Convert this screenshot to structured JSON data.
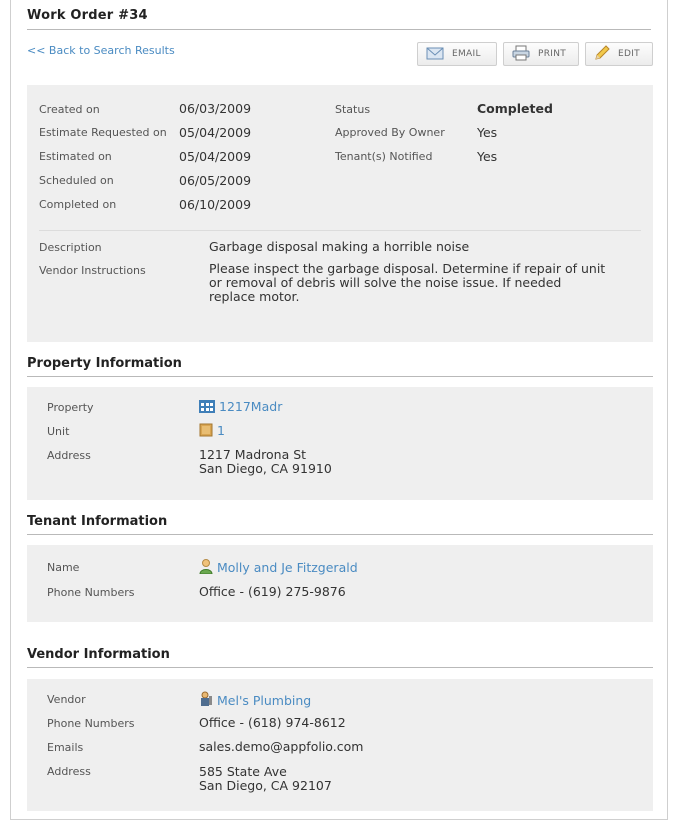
{
  "header": {
    "title": "Work Order #34",
    "back_link": "<< Back to Search Results"
  },
  "toolbar": {
    "email_label": "EMAIL",
    "print_label": "PRINT",
    "edit_label": "EDIT"
  },
  "work_order": {
    "created_on_label": "Created on",
    "created_on": "06/03/2009",
    "estimate_requested_label": "Estimate Requested on",
    "estimate_requested": "05/04/2009",
    "estimated_on_label": "Estimated on",
    "estimated_on": "05/04/2009",
    "scheduled_on_label": "Scheduled on",
    "scheduled_on": "06/05/2009",
    "completed_on_label": "Completed on",
    "completed_on": "06/10/2009",
    "status_label": "Status",
    "status": "Completed",
    "approved_label": "Approved By Owner",
    "approved": "Yes",
    "tenant_notified_label": "Tenant(s) Notified",
    "tenant_notified": "Yes",
    "description_label": "Description",
    "description": "Garbage disposal making a horrible noise",
    "vendor_instructions_label": "Vendor Instructions",
    "vendor_instructions_line1": "Please inspect the garbage disposal. Determine if repair of unit",
    "vendor_instructions_line2": "or removal of debris will solve the noise issue. If needed",
    "vendor_instructions_line3": "replace motor."
  },
  "property": {
    "section_title": "Property Information",
    "property_label": "Property",
    "property_value": "1217Madr",
    "unit_label": "Unit",
    "unit_value": "1",
    "address_label": "Address",
    "address_line1": "1217 Madrona St",
    "address_line2": "San Diego, CA 91910"
  },
  "tenant": {
    "section_title": "Tenant Information",
    "name_label": "Name",
    "name_value": "Molly and Je Fitzgerald",
    "phone_label": "Phone Numbers",
    "phone_value": "Office - (619) 275-9876"
  },
  "vendor": {
    "section_title": "Vendor Information",
    "vendor_label": "Vendor",
    "vendor_value": "Mel's Plumbing",
    "phone_label": "Phone Numbers",
    "phone_value": "Office - (618) 974-8612",
    "emails_label": "Emails",
    "emails_value": "sales.demo@appfolio.com",
    "address_label": "Address",
    "address_line1": "585 State Ave",
    "address_line2": "San Diego, CA 92107"
  },
  "icons": {
    "email": "envelope-icon",
    "print": "printer-icon",
    "edit": "pencil-icon",
    "property": "building-icon",
    "unit": "door-icon",
    "tenant": "person-icon",
    "vendor": "plumber-icon"
  },
  "colors": {
    "link": "#4a8bc2",
    "panel_bg": "#efefef"
  }
}
